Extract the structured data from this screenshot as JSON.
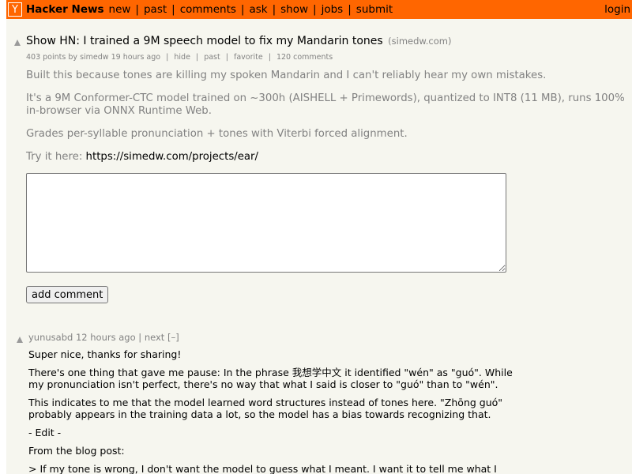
{
  "topbar": {
    "logo": "Y",
    "site_name": "Hacker News",
    "nav": [
      "new",
      "past",
      "comments",
      "ask",
      "show",
      "jobs",
      "submit"
    ],
    "login": "login"
  },
  "story": {
    "upvote_icon": "up-arrow-triangle",
    "title": "Show HN: I trained a 9M speech model to fix my Mandarin tones",
    "domain": "(simedw.com)",
    "points": "403 points",
    "by": "by",
    "user": "simedw",
    "age": "19 hours ago",
    "hide": "hide",
    "past": "past",
    "favorite": "favorite",
    "comments": "120 comments",
    "text": {
      "p1": "Built this because tones are killing my spoken Mandarin and I can't reliably hear my own mistakes.",
      "p2": "It's a 9M Conformer-CTC model trained on ~300h (AISHELL + Primewords), quantized to INT8 (11 MB), runs 100% in-browser via ONNX Runtime Web.",
      "p3": "Grades per-syllable pronunciation + tones with Viterbi forced alignment.",
      "p4_prefix": "Try it here:",
      "p4_url": "https://simedw.com/projects/ear/"
    }
  },
  "reply": {
    "textarea_value": "",
    "button_label": "add comment"
  },
  "comment": {
    "upvote_icon": "up-arrow-triangle",
    "user": "yunusabd",
    "age": "12 hours ago",
    "next": "next",
    "toggle": "[–]",
    "p1": "Super nice, thanks for sharing!",
    "p2": "There's one thing that gave me pause: In the phrase 我想学中文 it identified \"wén\" as \"guó\". While my pronunciation isn't perfect, there's no way that what I said is closer to \"guó\" than to \"wén\".",
    "p3": "This indicates to me that the model learned word structures instead of tones here. \"Zhōng guó\" probably appears in the training data a lot, so the model has a bias towards recognizing that.",
    "p4": "- Edit -",
    "p5": "From the blog post:",
    "p6": "> If my tone is wrong, I don't want the model to guess what I meant. I want it to tell me what I"
  },
  "colors": {
    "header_bg": "#ff6600",
    "page_bg": "#f6f6ef",
    "subtext": "#828282"
  }
}
